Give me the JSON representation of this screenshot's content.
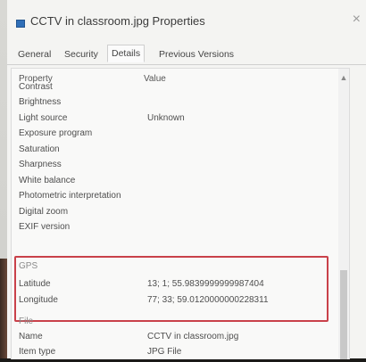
{
  "window": {
    "title": "CCTV in classroom.jpg Properties",
    "close_glyph": "×"
  },
  "tabs": [
    {
      "label": "General"
    },
    {
      "label": "Security"
    },
    {
      "label": "Details"
    },
    {
      "label": "Previous Versions"
    }
  ],
  "active_tab": "Details",
  "table": {
    "header": {
      "property": "Property",
      "value": "Value"
    },
    "rows": [
      {
        "property": "Contrast",
        "value": ""
      },
      {
        "property": "Brightness",
        "value": ""
      },
      {
        "property": "Light source",
        "value": "Unknown"
      },
      {
        "property": "Exposure program",
        "value": ""
      },
      {
        "property": "Saturation",
        "value": ""
      },
      {
        "property": "Sharpness",
        "value": ""
      },
      {
        "property": "White balance",
        "value": ""
      },
      {
        "property": "Photometric interpretation",
        "value": ""
      },
      {
        "property": "Digital zoom",
        "value": ""
      },
      {
        "property": "EXIF version",
        "value": ""
      }
    ],
    "gps_section": {
      "label": "GPS",
      "rows": [
        {
          "property": "Latitude",
          "value": "13; 1; 55.9839999999987404"
        },
        {
          "property": "Longitude",
          "value": "77; 33; 59.0120000000228311"
        }
      ]
    },
    "file_section": {
      "label": "File",
      "rows": [
        {
          "property": "Name",
          "value": "CCTV in classroom.jpg"
        },
        {
          "property": "Item type",
          "value": "JPG File"
        }
      ]
    }
  },
  "icons": {
    "title": "jpg-file-icon",
    "scroll_up": "chevron-up-icon",
    "close": "close-icon"
  },
  "colors": {
    "highlight_box": "#c9414a",
    "title_icon": "#2f6fb8"
  }
}
